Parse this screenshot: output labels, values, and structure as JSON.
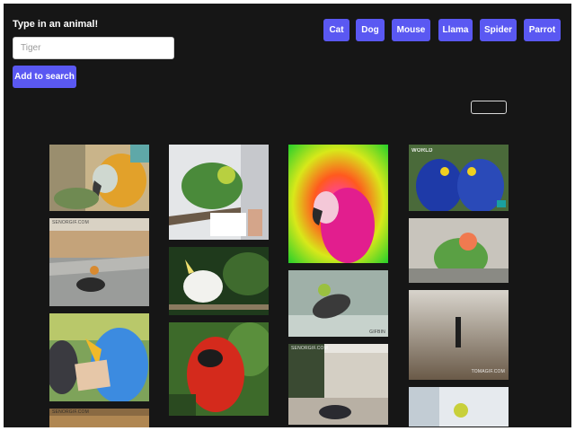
{
  "search": {
    "prompt": "Type in an animal!",
    "placeholder": "Tiger",
    "add_label": "Add to search"
  },
  "quick_buttons": [
    "Cat",
    "Dog",
    "Mouse",
    "Llama",
    "Spider",
    "Parrot"
  ],
  "colors": {
    "accent": "#5a58f2",
    "background": "#161616"
  },
  "gallery": {
    "watermarks": {
      "world": "WORLD",
      "senorgif_a": "SENORGIF.COM",
      "senorgif_b": "SENORGIF.COM",
      "senorgif_c": "SENORGIF.COM",
      "tomagif": "TOMAGIF.COM",
      "gifbin": "GIFBIN"
    }
  }
}
